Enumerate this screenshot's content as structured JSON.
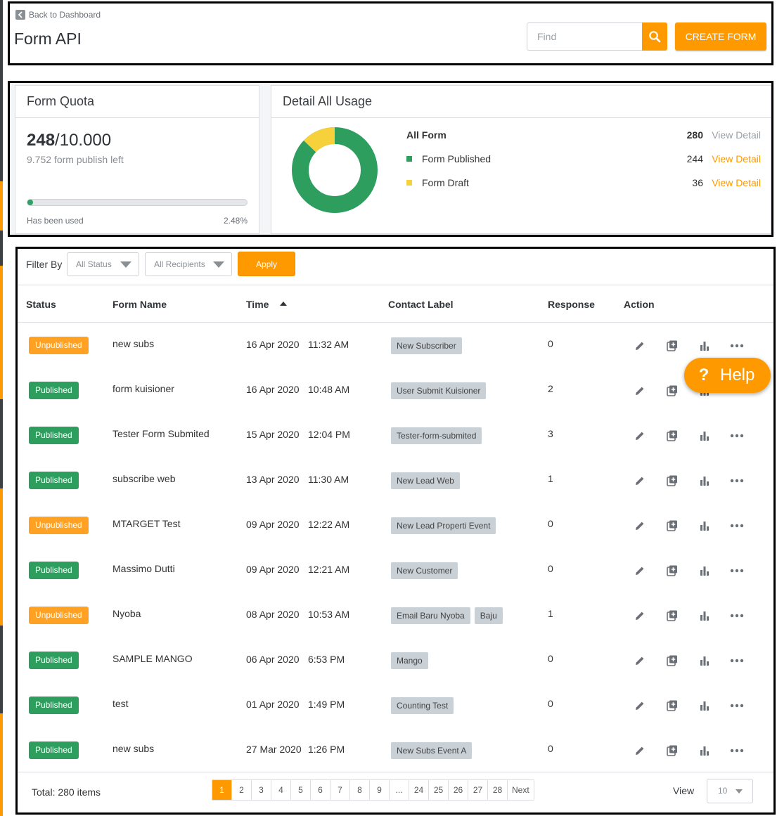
{
  "header": {
    "back_label": "Back to Dashboard",
    "title": "Form API",
    "search_placeholder": "Find",
    "create_label": "CREATE FORM"
  },
  "quota": {
    "title": "Form Quota",
    "used": "248",
    "total": "/10.000",
    "left_label": "9.752 form publish left",
    "used_label": "Has been used",
    "used_pct": "2.48%",
    "used_fraction": 0.0248
  },
  "usage": {
    "title": "Detail All Usage",
    "rows": [
      {
        "label": "All Form",
        "count": "280",
        "link": "View Detail"
      },
      {
        "label": "Form Published",
        "count": "244",
        "link": "View Detail"
      },
      {
        "label": "Form Draft",
        "count": "36",
        "link": "View Detail"
      }
    ],
    "colors": {
      "published": "#2e9e5e",
      "draft": "#f7d13b"
    }
  },
  "filter": {
    "label": "Filter By",
    "status": "All Status",
    "recipients": "All Recipients",
    "apply": "Apply"
  },
  "table": {
    "headers": [
      "Status",
      "Form Name",
      "Time",
      "Contact Label",
      "Response",
      "Action"
    ],
    "rows": [
      {
        "status": "Unpublished",
        "name": "new subs",
        "date": "16 Apr 2020",
        "time": "11:32 AM",
        "labels": [
          "New Subscriber"
        ],
        "response": "0"
      },
      {
        "status": "Published",
        "name": "form kuisioner",
        "date": "16 Apr 2020",
        "time": "10:48 AM",
        "labels": [
          "User Submit Kuisioner"
        ],
        "response": "2"
      },
      {
        "status": "Published",
        "name": "Tester Form Submited",
        "date": "15 Apr 2020",
        "time": "12:04 PM",
        "labels": [
          "Tester-form-submited"
        ],
        "response": "3"
      },
      {
        "status": "Published",
        "name": "subscribe web",
        "date": "13 Apr 2020",
        "time": "11:30 AM",
        "labels": [
          "New Lead Web"
        ],
        "response": "1"
      },
      {
        "status": "Unpublished",
        "name": "MTARGET Test",
        "date": "09 Apr 2020",
        "time": "12:22 AM",
        "labels": [
          "New Lead Properti Event"
        ],
        "response": "0"
      },
      {
        "status": "Published",
        "name": "Massimo Dutti",
        "date": "09 Apr 2020",
        "time": "12:21 AM",
        "labels": [
          "New Customer"
        ],
        "response": "0"
      },
      {
        "status": "Unpublished",
        "name": "Nyoba",
        "date": "08 Apr 2020",
        "time": "10:53 AM",
        "labels": [
          "Email Baru Nyoba",
          "Baju"
        ],
        "response": "1"
      },
      {
        "status": "Published",
        "name": "SAMPLE MANGO",
        "date": "06 Apr 2020",
        "time": "6:53 PM",
        "labels": [
          "Mango"
        ],
        "response": "0"
      },
      {
        "status": "Published",
        "name": "test",
        "date": "01 Apr 2020",
        "time": "1:49 PM",
        "labels": [
          "Counting Test"
        ],
        "response": "0"
      },
      {
        "status": "Published",
        "name": "new subs",
        "date": "27 Mar 2020",
        "time": "1:26 PM",
        "labels": [
          "New Subs Event A"
        ],
        "response": "0"
      }
    ],
    "action_icons": [
      "edit-icon",
      "duplicate-icon",
      "stats-icon",
      "more-icon"
    ]
  },
  "footer": {
    "total": "Total: 280 items",
    "pages": [
      "1",
      "2",
      "3",
      "4",
      "5",
      "6",
      "7",
      "8",
      "9",
      "...",
      "24",
      "25",
      "26",
      "27",
      "28",
      "Next"
    ],
    "active_page": "1",
    "view_label": "View",
    "view_value": "10"
  },
  "help": {
    "q": "?",
    "label": "Help"
  },
  "colors": {
    "accent": "#ff9900",
    "published": "#2e9e5e",
    "unpublished": "#ffa122"
  }
}
